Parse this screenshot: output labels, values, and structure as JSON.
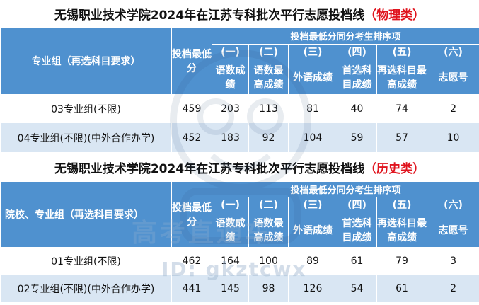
{
  "physics": {
    "title": "无锡职业技术学院2024年在江苏专科批次平行志愿投档线",
    "category": "（物理类）",
    "col_group": "专业组（再选科目要求）",
    "col_min": "投档最低分",
    "col_rank_header": "投档最低分同分考生排序项",
    "rank_nums": [
      "(一)",
      "(二)",
      "(三)",
      "(四)",
      "(五)",
      "(六)"
    ],
    "rank_names": [
      "语数成绩",
      "语数最高成绩",
      "外语成绩",
      "首选科目成绩",
      "再选科目最高成绩",
      "志愿号"
    ],
    "rows": [
      [
        "03专业组(不限)",
        "459",
        "203",
        "113",
        "81",
        "40",
        "74",
        "2"
      ],
      [
        "04专业组(不限)(中外合作办学)",
        "452",
        "183",
        "92",
        "104",
        "59",
        "57",
        "10"
      ]
    ]
  },
  "history": {
    "title": "无锡职业技术学院2024年在江苏专科批次平行志愿投档线",
    "category": "（历史类）",
    "col_group": "院校、专业组（再选科目要求）",
    "col_min": "投档最低分",
    "col_rank_header": "投档最低分同分考生排序项",
    "rank_nums": [
      "(一)",
      "(二)",
      "(三)",
      "(四)",
      "(五)",
      "(六)"
    ],
    "rank_names": [
      "语数成绩",
      "语数最高成绩",
      "外语成绩",
      "首选科目成绩",
      "再选科目最高成绩",
      "志愿号"
    ],
    "rows": [
      [
        "01专业组(不限)",
        "462",
        "164",
        "100",
        "89",
        "61",
        "79",
        "3"
      ],
      [
        "02专业组(不限)(中外合作办学)",
        "441",
        "145",
        "98",
        "126",
        "54",
        "61",
        "2"
      ]
    ]
  },
  "watermark": {
    "id_text": "ID: gkztcwx",
    "slogan": "高考直通车"
  },
  "colors": {
    "header_bg": "#4f91cf",
    "stripe_bg": "#d9e6f3",
    "category_red": "#e0141e"
  }
}
